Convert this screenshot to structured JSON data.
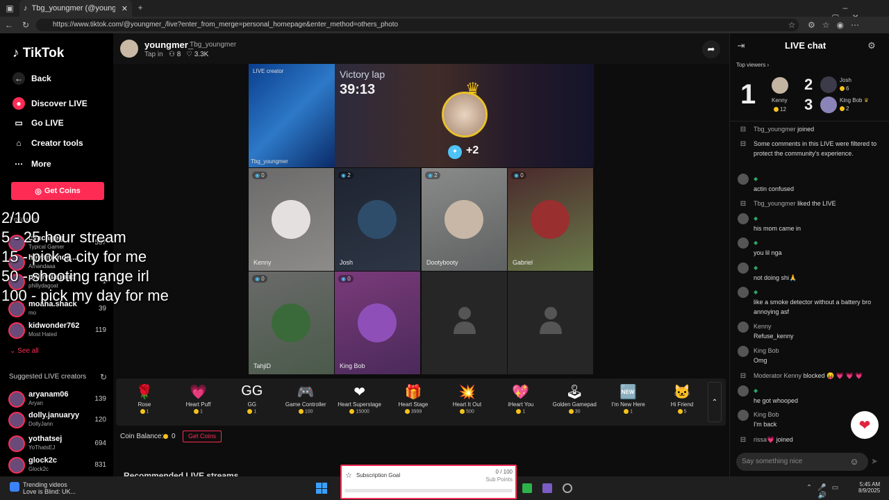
{
  "browser": {
    "tab_title": "Tbg_youngmer (@youngme",
    "url": "https://www.tiktok.com/@youngmer_/live?enter_from_merge=personal_homepage&enter_method=others_photo"
  },
  "nav": {
    "logo": "TikTok",
    "back": "Back",
    "items": [
      "Discover LIVE",
      "Go LIVE",
      "Creator tools",
      "More"
    ],
    "get_coins": "Get Coins",
    "following_label": "Following",
    "following": [
      {
        "name": "cyacageg",
        "sub": "Typical Gamer",
        "count": "537"
      },
      {
        "name": "heyamanda...",
        "sub": "Amandaaa",
        "count": ""
      },
      {
        "name": "phillydagoat",
        "sub": "phillydagoat",
        "count": "1"
      },
      {
        "name": "moaha.shack",
        "sub": "mo",
        "count": "39"
      },
      {
        "name": "kidwonder762",
        "sub": "Most Hated",
        "count": "119"
      }
    ],
    "see_all": "See all",
    "suggested_label": "Suggested LIVE creators",
    "suggested": [
      {
        "name": "aryanam06",
        "sub": "Aryan",
        "count": "139"
      },
      {
        "name": "dolly.januaryy",
        "sub": "DollyJann",
        "count": "120"
      },
      {
        "name": "yothatsej",
        "sub": "YoThatsEJ",
        "count": "694"
      },
      {
        "name": "glock2c",
        "sub": "Glock2c",
        "count": "831"
      }
    ]
  },
  "overlay_lines": [
    "2/100",
    "5 - 25 hour stream",
    "15 - pick a city for me",
    "50 - shooting range irl",
    "100 - pick my day for me"
  ],
  "host": {
    "name": "youngmer_",
    "handle": "Tbg_youngmer",
    "tap_in": "Tap in",
    "viewers": "8",
    "likes": "3.3K",
    "label_live_creator": "LIVE creator",
    "host_tag": "Tbg_youngmer"
  },
  "victory": {
    "title": "Victory lap",
    "time": "39:13",
    "plus": "+2"
  },
  "guests": [
    {
      "name": "Kenny",
      "badge": "0"
    },
    {
      "name": "Josh",
      "badge": "2"
    },
    {
      "name": "Dootybooty",
      "badge": "2"
    },
    {
      "name": "Gabriel",
      "badge": "0"
    },
    {
      "name": "TahjiD",
      "badge": "0"
    },
    {
      "name": "King Bob",
      "badge": "0"
    }
  ],
  "gifts": [
    {
      "name": "Rose",
      "price": "1",
      "icon": "rose-icon",
      "glyph": "🌹"
    },
    {
      "name": "Heart Puff",
      "price": "1",
      "icon": "heart-puff-icon",
      "glyph": "💗"
    },
    {
      "name": "GG",
      "price": "1",
      "icon": "gg-icon",
      "glyph": "GG"
    },
    {
      "name": "Game Controller",
      "price": "100",
      "icon": "controller-icon",
      "glyph": "🎮"
    },
    {
      "name": "Heart Superstage",
      "price": "15000",
      "icon": "superstage-icon",
      "glyph": "❤"
    },
    {
      "name": "Heart Stage",
      "price": "3999",
      "icon": "stage-icon",
      "glyph": "🎁"
    },
    {
      "name": "Heart It Out",
      "price": "500",
      "icon": "heart-it-out-icon",
      "glyph": "💥"
    },
    {
      "name": "iHeart You",
      "price": "1",
      "icon": "iheart-icon",
      "glyph": "💖"
    },
    {
      "name": "Golden Gamepad",
      "price": "30",
      "icon": "gamepad-icon",
      "glyph": "🕹"
    },
    {
      "name": "I'm New Here",
      "price": "1",
      "icon": "new-here-icon",
      "glyph": "🆕"
    },
    {
      "name": "Hi Friend",
      "price": "5",
      "icon": "hi-friend-icon",
      "glyph": "🐱"
    }
  ],
  "balance": {
    "label": "Coin Balance:",
    "value": "0",
    "get_coins": "Get Coins"
  },
  "recommended": "Recommended LIVE streams",
  "chat": {
    "title": "LIVE chat",
    "top_viewers": "Top viewers",
    "ranks": [
      {
        "rank": "1",
        "name": "Kenny",
        "score": "12"
      },
      {
        "rank": "2",
        "name": "Josh",
        "score": "6"
      },
      {
        "rank": "3",
        "name": "King Bob",
        "score": "2"
      }
    ],
    "messages": [
      {
        "user": "Tbg_youngmer",
        "text": "joined",
        "type": "system"
      },
      {
        "user": "",
        "text": "Some comments in this LIVE were filtered to protect the community's experience.",
        "type": "system"
      },
      {
        "user": "",
        "text": "actin confused",
        "type": "comment"
      },
      {
        "user": "Tbg_youngmer",
        "text": "liked the LIVE",
        "type": "system"
      },
      {
        "user": "",
        "text": "his mom came in",
        "type": "comment"
      },
      {
        "user": "",
        "text": "you lil nga",
        "type": "comment"
      },
      {
        "user": "",
        "text": "not doing shi🙏",
        "type": "comment"
      },
      {
        "user": "",
        "text": "like a smoke detector without a battery bro annoying asf",
        "type": "comment"
      },
      {
        "user": "Kenny",
        "text": "Refuse_kenny",
        "type": "comment"
      },
      {
        "user": "King Bob",
        "text": "Omg",
        "type": "comment"
      },
      {
        "user": "Moderator Kenny",
        "text": "blocked 😝 💗 💗 💗",
        "type": "system"
      },
      {
        "user": "",
        "text": "he got whooped",
        "type": "comment"
      },
      {
        "user": "King Bob",
        "text": "I'm back",
        "type": "comment"
      },
      {
        "user": "rissa💗",
        "text": "joined",
        "type": "system"
      }
    ],
    "input_placeholder": "Say something nice"
  },
  "subscription": {
    "label": "Subscription Goal",
    "progress": "0 / 100",
    "sub": "Sub Points"
  },
  "taskbar": {
    "trend_title": "Trending videos",
    "trend_sub": "Love is Blind: UK...",
    "time": "5:45 AM",
    "date": "8/9/2025"
  },
  "colors": {
    "brand": "#fe2c55",
    "coin": "#f6c21a"
  }
}
